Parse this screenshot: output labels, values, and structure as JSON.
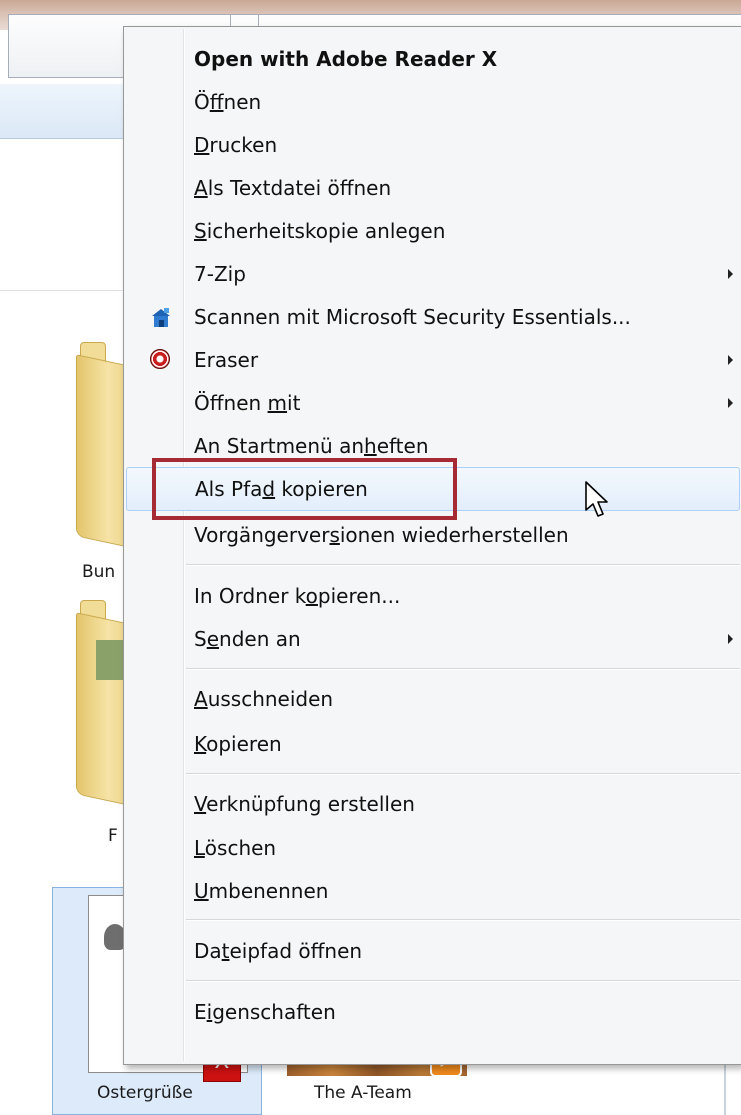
{
  "explorer": {
    "left_labels": {
      "bunte": "Bun",
      "fotos": "F"
    },
    "tiles": [
      {
        "name": "Ostergrüße",
        "type": "pdf"
      },
      {
        "name": "The A-Team",
        "type": "video"
      }
    ]
  },
  "context_menu": {
    "items": [
      {
        "label": "Open with Adobe Reader X",
        "bold": true
      },
      {
        "label": "Öffnen",
        "ul": "f"
      },
      {
        "label": "Drucken",
        "ul": "D"
      },
      {
        "label": "Als Textdatei öffnen",
        "ul": "A"
      },
      {
        "label": "Sicherheitskopie anlegen",
        "ul": "S"
      },
      {
        "label": "7-Zip",
        "submenu": true
      },
      {
        "label": "Scannen mit Microsoft Security Essentials...",
        "icon": "microsoft-security-essentials-icon"
      },
      {
        "label": "Eraser",
        "icon": "eraser-icon",
        "submenu": true
      },
      {
        "label": "Öffnen mit",
        "ul": "m",
        "submenu": true
      },
      {
        "label": "An Startmenü anheften",
        "ul": "h"
      },
      {
        "label": "Als Pfad kopieren",
        "ul": "d",
        "highlighted": true
      },
      {
        "label": "Vorgängerversionen wiederherstellen",
        "ul": "s"
      },
      {
        "label": "In Ordner kopieren...",
        "ul": "o"
      },
      {
        "label": "Senden an",
        "ul": "e",
        "submenu": true
      },
      {
        "label": "Ausschneiden",
        "ul": "A"
      },
      {
        "label": "Kopieren",
        "ul": "K"
      },
      {
        "label": "Verknüpfung erstellen",
        "ul": "V"
      },
      {
        "label": "Löschen",
        "ul": "L"
      },
      {
        "label": "Umbenennen",
        "ul": "U"
      },
      {
        "label": "Dateipfad öffnen",
        "ul": "t"
      },
      {
        "label": "Eigenschaften",
        "ul": "i"
      }
    ]
  },
  "colors": {
    "highlight_box": "#a52a34",
    "menu_background": "#f5f6f7",
    "hover_border": "#aecff7",
    "selection_tile": "#dceaf9"
  }
}
